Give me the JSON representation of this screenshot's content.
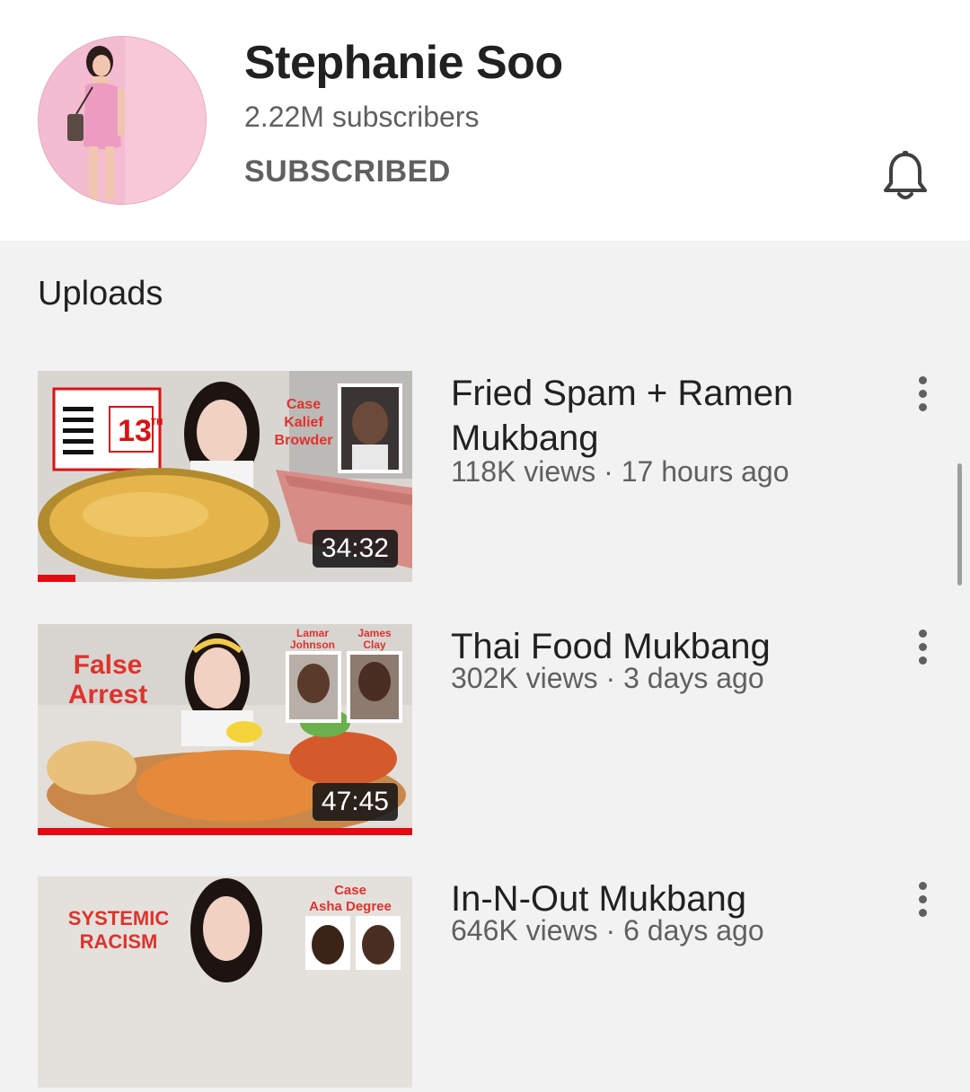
{
  "channel": {
    "name": "Stephanie Soo",
    "subscribers": "2.22M subscribers",
    "subscribe_state": "SUBSCRIBED",
    "bell_icon": "bell-icon"
  },
  "uploads": {
    "section_title": "Uploads",
    "videos": [
      {
        "title": "Fried Spam + Ramen Mukbang",
        "meta": "118K views · 17 hours ago",
        "duration": "34:32",
        "progress_fraction": 0.1,
        "thumb_text": {
          "badge": "13TH",
          "case_label": "Case\nKalief\nBrowder"
        }
      },
      {
        "title": "Thai Food Mukbang",
        "meta": "302K views · 3 days ago",
        "duration": "47:45",
        "progress_fraction": 1.0,
        "thumb_text": {
          "headline": "False\nArrest",
          "name_a": "Lamar\nJohnson",
          "name_b": "James\nClay"
        }
      },
      {
        "title": "In-N-Out Mukbang",
        "meta": "646K views · 6 days ago",
        "thumb_text": {
          "headline": "SYSTEMIC\nRACISM",
          "case_label": "Case\nAsha Degree"
        }
      }
    ]
  },
  "colors": {
    "accent_red": "#e50914",
    "text_primary": "#212121",
    "text_secondary": "#606060"
  }
}
